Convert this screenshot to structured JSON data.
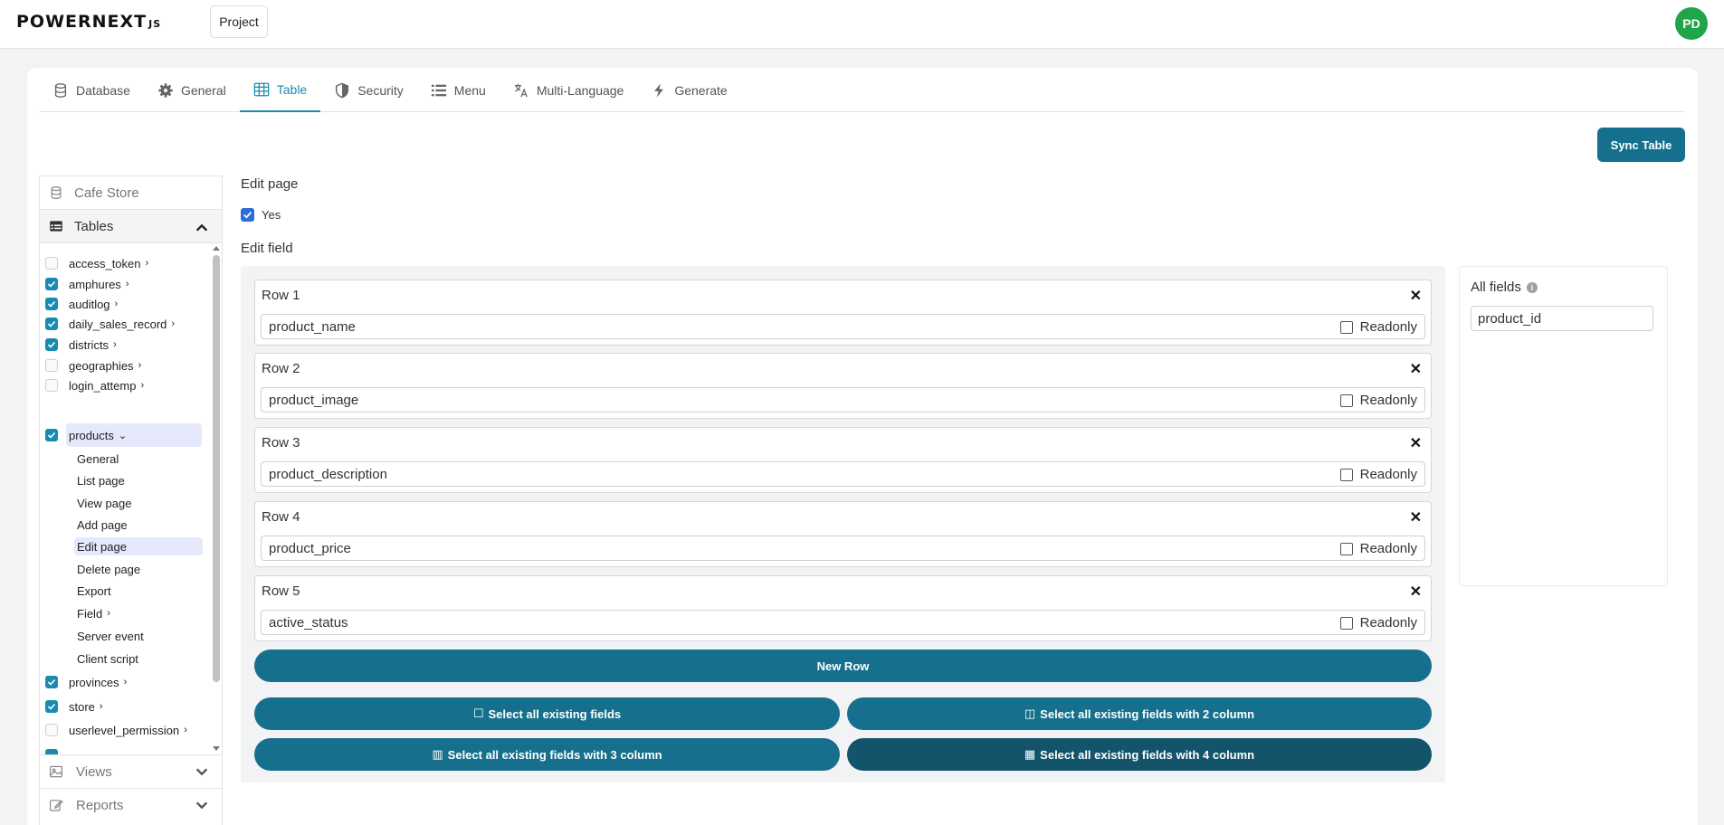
{
  "topbar": {
    "logo_text": "POWERNEXT",
    "logo_suffix": "JS",
    "project_label": "Project",
    "avatar_initials": "PD"
  },
  "tabs": [
    {
      "label": "Database",
      "icon": "database-icon"
    },
    {
      "label": "General",
      "icon": "gear-icon"
    },
    {
      "label": "Table",
      "icon": "table-icon",
      "active": true
    },
    {
      "label": "Security",
      "icon": "shield-icon"
    },
    {
      "label": "Menu",
      "icon": "list-icon"
    },
    {
      "label": "Multi-Language",
      "icon": "translate-icon"
    },
    {
      "label": "Generate",
      "icon": "bolt-icon"
    }
  ],
  "sync_button": "Sync Table",
  "sidebar": {
    "db_name": "Cafe Store",
    "tables_label": "Tables",
    "tables": [
      {
        "name": "access_token",
        "checked": false,
        "expanded": false
      },
      {
        "name": "amphures",
        "checked": true,
        "expanded": false
      },
      {
        "name": "auditlog",
        "checked": true,
        "expanded": false
      },
      {
        "name": "daily_sales_record",
        "checked": true,
        "expanded": false
      },
      {
        "name": "districts",
        "checked": true,
        "expanded": false
      },
      {
        "name": "geographies",
        "checked": false,
        "expanded": false
      },
      {
        "name": "login_attemp",
        "checked": false,
        "expanded": false
      },
      {
        "name": "products",
        "checked": true,
        "expanded": true
      },
      {
        "name": "provinces",
        "checked": true,
        "expanded": false
      },
      {
        "name": "store",
        "checked": true,
        "expanded": false
      },
      {
        "name": "userlevel_permission",
        "checked": false,
        "expanded": false
      }
    ],
    "products_children": [
      "General",
      "List page",
      "View page",
      "Add page",
      "Edit page",
      "Delete page",
      "Export",
      "Field",
      "Server event",
      "Client script"
    ],
    "active_child": "Edit page",
    "views_label": "Views",
    "reports_label": "Reports"
  },
  "main": {
    "edit_page_label": "Edit page",
    "yes_label": "Yes",
    "edit_field_label": "Edit field",
    "rows": [
      {
        "title": "Row 1",
        "field": "product_name",
        "readonly_label": "Readonly"
      },
      {
        "title": "Row 2",
        "field": "product_image",
        "readonly_label": "Readonly"
      },
      {
        "title": "Row 3",
        "field": "product_description",
        "readonly_label": "Readonly"
      },
      {
        "title": "Row 4",
        "field": "product_price",
        "readonly_label": "Readonly"
      },
      {
        "title": "Row 5",
        "field": "active_status",
        "readonly_label": "Readonly"
      }
    ],
    "new_row_label": "New Row",
    "select_buttons": [
      "Select all existing fields",
      "Select all existing fields with 2 column",
      "Select all existing fields with 3 column",
      "Select all existing fields with 4 column"
    ]
  },
  "all_fields": {
    "title": "All fields",
    "fields": [
      "product_id"
    ]
  },
  "colors": {
    "accent": "#1a8bb0",
    "button": "#16708d",
    "button_dark": "#13546b",
    "avatar": "#1fa64a"
  }
}
